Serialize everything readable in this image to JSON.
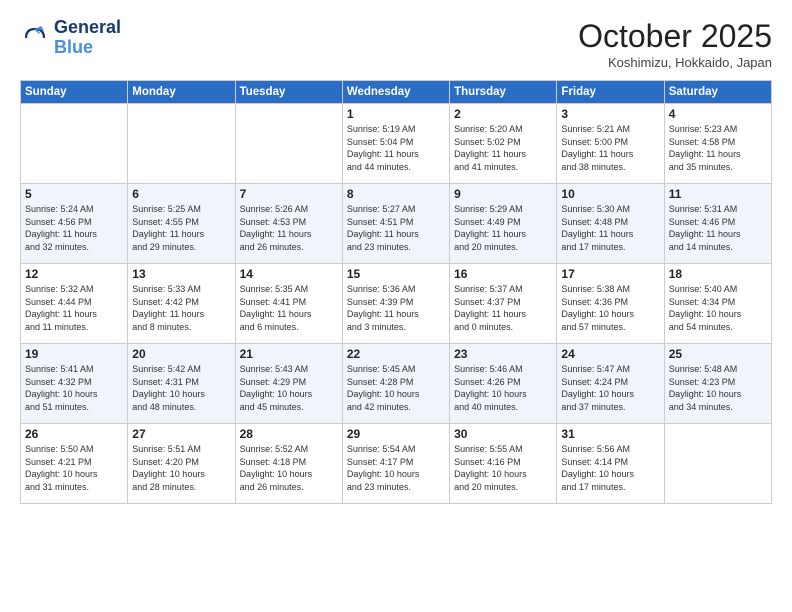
{
  "logo": {
    "line1": "General",
    "line2": "Blue"
  },
  "title": "October 2025",
  "location": "Koshimizu, Hokkaido, Japan",
  "days_of_week": [
    "Sunday",
    "Monday",
    "Tuesday",
    "Wednesday",
    "Thursday",
    "Friday",
    "Saturday"
  ],
  "weeks": [
    [
      {
        "day": "",
        "info": ""
      },
      {
        "day": "",
        "info": ""
      },
      {
        "day": "",
        "info": ""
      },
      {
        "day": "1",
        "info": "Sunrise: 5:19 AM\nSunset: 5:04 PM\nDaylight: 11 hours\nand 44 minutes."
      },
      {
        "day": "2",
        "info": "Sunrise: 5:20 AM\nSunset: 5:02 PM\nDaylight: 11 hours\nand 41 minutes."
      },
      {
        "day": "3",
        "info": "Sunrise: 5:21 AM\nSunset: 5:00 PM\nDaylight: 11 hours\nand 38 minutes."
      },
      {
        "day": "4",
        "info": "Sunrise: 5:23 AM\nSunset: 4:58 PM\nDaylight: 11 hours\nand 35 minutes."
      }
    ],
    [
      {
        "day": "5",
        "info": "Sunrise: 5:24 AM\nSunset: 4:56 PM\nDaylight: 11 hours\nand 32 minutes."
      },
      {
        "day": "6",
        "info": "Sunrise: 5:25 AM\nSunset: 4:55 PM\nDaylight: 11 hours\nand 29 minutes."
      },
      {
        "day": "7",
        "info": "Sunrise: 5:26 AM\nSunset: 4:53 PM\nDaylight: 11 hours\nand 26 minutes."
      },
      {
        "day": "8",
        "info": "Sunrise: 5:27 AM\nSunset: 4:51 PM\nDaylight: 11 hours\nand 23 minutes."
      },
      {
        "day": "9",
        "info": "Sunrise: 5:29 AM\nSunset: 4:49 PM\nDaylight: 11 hours\nand 20 minutes."
      },
      {
        "day": "10",
        "info": "Sunrise: 5:30 AM\nSunset: 4:48 PM\nDaylight: 11 hours\nand 17 minutes."
      },
      {
        "day": "11",
        "info": "Sunrise: 5:31 AM\nSunset: 4:46 PM\nDaylight: 11 hours\nand 14 minutes."
      }
    ],
    [
      {
        "day": "12",
        "info": "Sunrise: 5:32 AM\nSunset: 4:44 PM\nDaylight: 11 hours\nand 11 minutes."
      },
      {
        "day": "13",
        "info": "Sunrise: 5:33 AM\nSunset: 4:42 PM\nDaylight: 11 hours\nand 8 minutes."
      },
      {
        "day": "14",
        "info": "Sunrise: 5:35 AM\nSunset: 4:41 PM\nDaylight: 11 hours\nand 6 minutes."
      },
      {
        "day": "15",
        "info": "Sunrise: 5:36 AM\nSunset: 4:39 PM\nDaylight: 11 hours\nand 3 minutes."
      },
      {
        "day": "16",
        "info": "Sunrise: 5:37 AM\nSunset: 4:37 PM\nDaylight: 11 hours\nand 0 minutes."
      },
      {
        "day": "17",
        "info": "Sunrise: 5:38 AM\nSunset: 4:36 PM\nDaylight: 10 hours\nand 57 minutes."
      },
      {
        "day": "18",
        "info": "Sunrise: 5:40 AM\nSunset: 4:34 PM\nDaylight: 10 hours\nand 54 minutes."
      }
    ],
    [
      {
        "day": "19",
        "info": "Sunrise: 5:41 AM\nSunset: 4:32 PM\nDaylight: 10 hours\nand 51 minutes."
      },
      {
        "day": "20",
        "info": "Sunrise: 5:42 AM\nSunset: 4:31 PM\nDaylight: 10 hours\nand 48 minutes."
      },
      {
        "day": "21",
        "info": "Sunrise: 5:43 AM\nSunset: 4:29 PM\nDaylight: 10 hours\nand 45 minutes."
      },
      {
        "day": "22",
        "info": "Sunrise: 5:45 AM\nSunset: 4:28 PM\nDaylight: 10 hours\nand 42 minutes."
      },
      {
        "day": "23",
        "info": "Sunrise: 5:46 AM\nSunset: 4:26 PM\nDaylight: 10 hours\nand 40 minutes."
      },
      {
        "day": "24",
        "info": "Sunrise: 5:47 AM\nSunset: 4:24 PM\nDaylight: 10 hours\nand 37 minutes."
      },
      {
        "day": "25",
        "info": "Sunrise: 5:48 AM\nSunset: 4:23 PM\nDaylight: 10 hours\nand 34 minutes."
      }
    ],
    [
      {
        "day": "26",
        "info": "Sunrise: 5:50 AM\nSunset: 4:21 PM\nDaylight: 10 hours\nand 31 minutes."
      },
      {
        "day": "27",
        "info": "Sunrise: 5:51 AM\nSunset: 4:20 PM\nDaylight: 10 hours\nand 28 minutes."
      },
      {
        "day": "28",
        "info": "Sunrise: 5:52 AM\nSunset: 4:18 PM\nDaylight: 10 hours\nand 26 minutes."
      },
      {
        "day": "29",
        "info": "Sunrise: 5:54 AM\nSunset: 4:17 PM\nDaylight: 10 hours\nand 23 minutes."
      },
      {
        "day": "30",
        "info": "Sunrise: 5:55 AM\nSunset: 4:16 PM\nDaylight: 10 hours\nand 20 minutes."
      },
      {
        "day": "31",
        "info": "Sunrise: 5:56 AM\nSunset: 4:14 PM\nDaylight: 10 hours\nand 17 minutes."
      },
      {
        "day": "",
        "info": ""
      }
    ]
  ]
}
